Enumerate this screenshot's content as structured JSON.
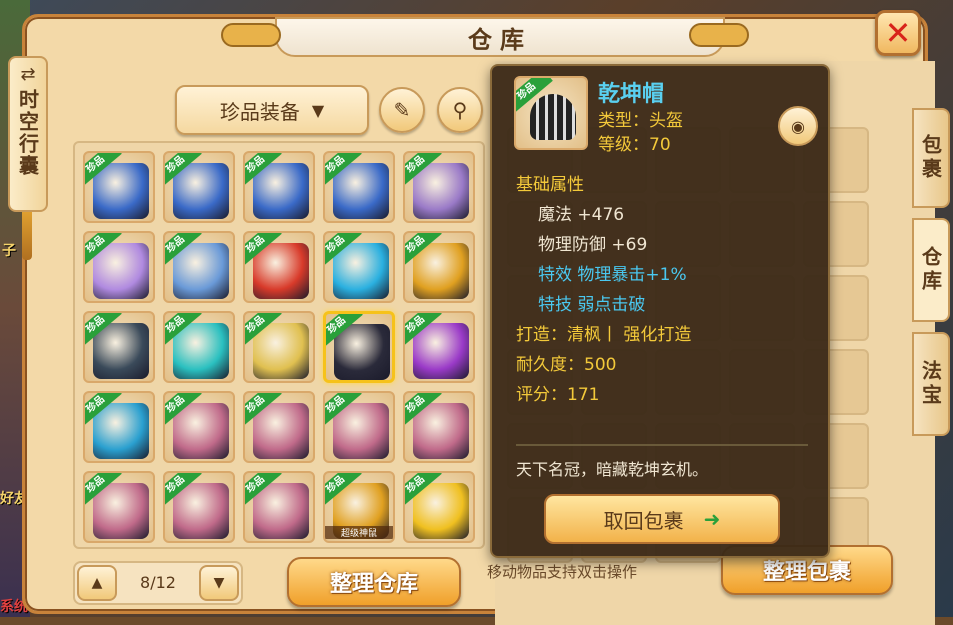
{
  "window": {
    "title": "仓库",
    "close_icon": "close-x-icon"
  },
  "left_tab": {
    "arrow_icon": "swap-arrows-icon",
    "label": "时空行囊"
  },
  "filter": {
    "selected": "珍品装备",
    "edit_icon": "pencil-icon",
    "search_icon": "magnifier-icon"
  },
  "warehouse": {
    "badge": "珍品",
    "slots": [
      {
        "name": "blue-sword",
        "color": "#3a6ac8"
      },
      {
        "name": "blue-sword",
        "color": "#3a6ac8"
      },
      {
        "name": "blue-sword",
        "color": "#3a6ac8"
      },
      {
        "name": "blue-sword",
        "color": "#3a6ac8"
      },
      {
        "name": "crescent-bow",
        "color": "#9a7ac8"
      },
      {
        "name": "crescent-bow",
        "color": "#b08ae0"
      },
      {
        "name": "blue-bow",
        "color": "#6a9ad8"
      },
      {
        "name": "red-fan",
        "color": "#d83a2a"
      },
      {
        "name": "blue-fan",
        "color": "#2ab0e0"
      },
      {
        "name": "golden-axe",
        "color": "#e0a020"
      },
      {
        "name": "dark-helmet",
        "color": "#3a4a5a"
      },
      {
        "name": "crystal-dagger",
        "color": "#2ac0c0"
      },
      {
        "name": "golden-staff",
        "color": "#e0c050"
      },
      {
        "name": "qiankun-hat",
        "color": "#2a2a3a"
      },
      {
        "name": "purple-hat",
        "color": "#9a3ac8"
      },
      {
        "name": "blue-cape",
        "color": "#2aa0d0"
      },
      {
        "name": "pink-armor",
        "color": "#c06a8a"
      },
      {
        "name": "pink-armor",
        "color": "#c06a8a"
      },
      {
        "name": "pink-armor",
        "color": "#c06a8a"
      },
      {
        "name": "pink-armor",
        "color": "#c06a8a"
      },
      {
        "name": "pink-armor",
        "color": "#c06a8a"
      },
      {
        "name": "pink-armor",
        "color": "#c06a8a"
      },
      {
        "name": "pink-armor",
        "color": "#c06a8a"
      },
      {
        "name": "golden-armor",
        "color": "#e0a020",
        "sub": "超级神鼠"
      },
      {
        "name": "golden-coin",
        "color": "#f0c020"
      }
    ],
    "selected_index": 13
  },
  "pager": {
    "text": "8/12",
    "up_icon": "chevron-up-icon",
    "down_icon": "chevron-down-icon"
  },
  "sort_warehouse": "整理仓库",
  "inventory": {
    "hint": "移动物品支持双击操作",
    "sort_label": "整理包裹"
  },
  "side_tabs": [
    "包裹",
    "仓库",
    "法宝"
  ],
  "tooltip": {
    "name": "乾坤帽",
    "type": "类型：头盔",
    "level": "等级：70",
    "badge": "珍品",
    "eye_icon": "eye-icon",
    "section": "基础属性",
    "attrs": [
      "魔法 +476",
      "物理防御 +69"
    ],
    "effect": "特效  物理暴击+1%",
    "skill": "特技  弱点击破",
    "craft": "打造：清枫丨    强化打造",
    "durability": "耐久度：500",
    "score": "评分：171",
    "description": "天下名冠，暗藏乾坤玄机。",
    "action": "取回包裹",
    "action_icon": "arrow-right-icon"
  },
  "background": {
    "left_labels": [
      "子",
      "好友",
      "系统"
    ]
  }
}
